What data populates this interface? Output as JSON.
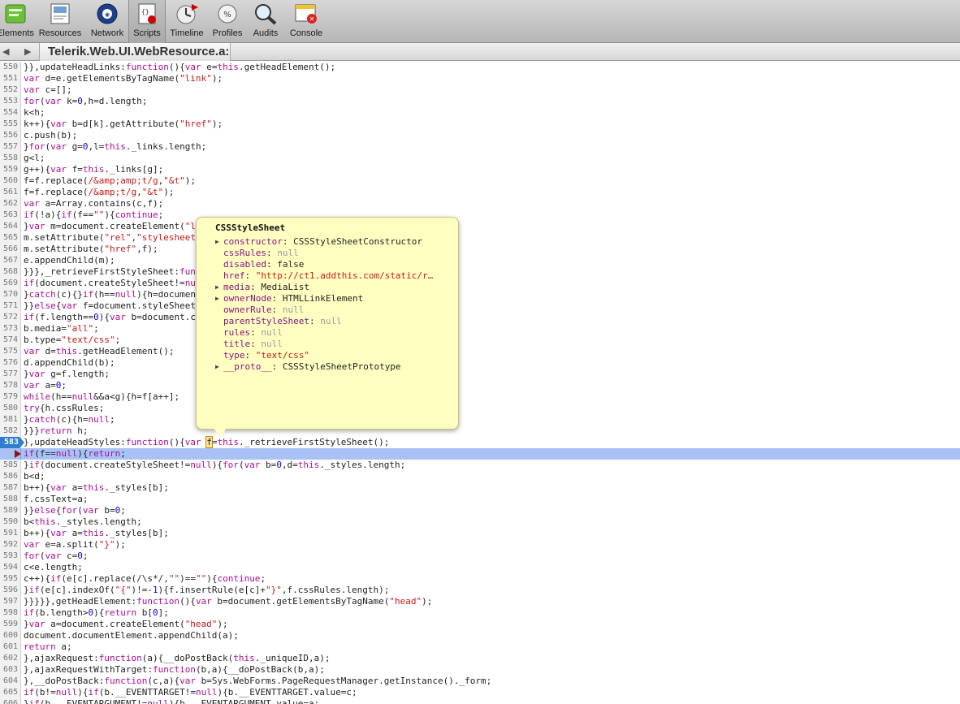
{
  "toolbar": {
    "items": [
      {
        "label": "Elements",
        "icon": "elements-icon",
        "active": false,
        "w": 46
      },
      {
        "label": "Resources",
        "icon": "resources-icon",
        "active": false,
        "w": 64
      },
      {
        "label": "Network",
        "icon": "network-icon",
        "active": false,
        "w": 52
      },
      {
        "label": "Scripts",
        "icon": "scripts-icon",
        "active": true,
        "w": 46
      },
      {
        "label": "Timeline",
        "icon": "timeline-icon",
        "active": false,
        "w": 52
      },
      {
        "label": "Profiles",
        "icon": "profiles-icon",
        "active": false,
        "w": 48
      },
      {
        "label": "Audits",
        "icon": "audits-icon",
        "active": false,
        "w": 46
      },
      {
        "label": "Console",
        "icon": "console-icon",
        "active": false,
        "w": 54
      }
    ]
  },
  "tabbar": {
    "back_icon": "back-arrow-icon",
    "forward_icon": "forward-arrow-icon",
    "file_tab": "Telerik.Web.UI.WebResource.a:"
  },
  "code": {
    "lines": [
      {
        "n": "550",
        "t": "}},updateHeadLinks:function(){var e=this.getHeadElement();"
      },
      {
        "n": "551",
        "t": "var d=e.getElementsByTagName(\"link\");"
      },
      {
        "n": "552",
        "t": "var c=[];"
      },
      {
        "n": "553",
        "t": "for(var k=0,h=d.length;"
      },
      {
        "n": "554",
        "t": "k<h;"
      },
      {
        "n": "555",
        "t": "k++){var b=d[k].getAttribute(\"href\");"
      },
      {
        "n": "556",
        "t": "c.push(b);"
      },
      {
        "n": "557",
        "t": "}for(var g=0,l=this._links.length;"
      },
      {
        "n": "558",
        "t": "g<l;"
      },
      {
        "n": "559",
        "t": "g++){var f=this._links[g];"
      },
      {
        "n": "560",
        "t": "f=f.replace(/&amp;amp;t/g,\"&t\");"
      },
      {
        "n": "561",
        "t": "f=f.replace(/&amp;t/g,\"&t\");"
      },
      {
        "n": "562",
        "t": "var a=Array.contains(c,f);"
      },
      {
        "n": "563",
        "t": "if(!a){if(f==\"\"){continue;"
      },
      {
        "n": "564",
        "t": "}var m=document.createElement(\"link\");"
      },
      {
        "n": "565",
        "t": "m.setAttribute(\"rel\",\"stylesheet\");"
      },
      {
        "n": "566",
        "t": "m.setAttribute(\"href\",f);"
      },
      {
        "n": "567",
        "t": "e.appendChild(m);"
      },
      {
        "n": "568",
        "t": "}}},_retrieveFirstStyleSheet:function(){"
      },
      {
        "n": "569",
        "t": "if(document.createStyleSheet!=null){"
      },
      {
        "n": "570",
        "t": "}catch(c){}if(h==null){h=document"
      },
      {
        "n": "571",
        "t": "}}else{var f=document.styleSheets;"
      },
      {
        "n": "572",
        "t": "if(f.length==0){var b=document.createElement(\"style\");"
      },
      {
        "n": "573",
        "t": "b.media=\"all\";"
      },
      {
        "n": "574",
        "t": "b.type=\"text/css\";"
      },
      {
        "n": "575",
        "t": "var d=this.getHeadElement();"
      },
      {
        "n": "576",
        "t": "d.appendChild(b);"
      },
      {
        "n": "577",
        "t": "}var g=f.length;"
      },
      {
        "n": "578",
        "t": "var a=0;"
      },
      {
        "n": "579",
        "t": "while(h==null&&a<g){h=f[a++];"
      },
      {
        "n": "580",
        "t": "try{h.cssRules;"
      },
      {
        "n": "581",
        "t": "}catch(c){h=null;"
      },
      {
        "n": "582",
        "t": "}}}return h;"
      },
      {
        "n": "583",
        "t": "},updateHeadStyles:function(){var f=this._retrieveFirstStyleSheet();",
        "breakpoint": true
      },
      {
        "n": "584",
        "t": "if(f==null){return;",
        "exec": true
      },
      {
        "n": "585",
        "t": "}if(document.createStyleSheet!=null){for(var b=0,d=this._styles.length;"
      },
      {
        "n": "586",
        "t": "b<d;"
      },
      {
        "n": "587",
        "t": "b++){var a=this._styles[b];"
      },
      {
        "n": "588",
        "t": "f.cssText=a;"
      },
      {
        "n": "589",
        "t": "}}else{for(var b=0;"
      },
      {
        "n": "590",
        "t": "b<this._styles.length;"
      },
      {
        "n": "591",
        "t": "b++){var a=this._styles[b];"
      },
      {
        "n": "592",
        "t": "var e=a.split(\"}\");"
      },
      {
        "n": "593",
        "t": "for(var c=0;"
      },
      {
        "n": "594",
        "t": "c<e.length;"
      },
      {
        "n": "595",
        "t": "c++){if(e[c].replace(/\\s*/,\"\")==\"\"){continue;"
      },
      {
        "n": "596",
        "t": "}if(e[c].indexOf(\"{\")!=-1){f.insertRule(e[c]+\"}\",f.cssRules.length);"
      },
      {
        "n": "597",
        "t": "}}}}},getHeadElement:function(){var b=document.getElementsByTagName(\"head\");"
      },
      {
        "n": "598",
        "t": "if(b.length>0){return b[0];"
      },
      {
        "n": "599",
        "t": "}var a=document.createElement(\"head\");"
      },
      {
        "n": "600",
        "t": "document.documentElement.appendChild(a);"
      },
      {
        "n": "601",
        "t": "return a;"
      },
      {
        "n": "602",
        "t": "},ajaxRequest:function(a){__doPostBack(this._uniqueID,a);"
      },
      {
        "n": "603",
        "t": "},ajaxRequestWithTarget:function(b,a){__doPostBack(b,a);"
      },
      {
        "n": "604",
        "t": "},__doPostBack:function(c,a){var b=Sys.WebForms.PageRequestManager.getInstance()._form;"
      },
      {
        "n": "605",
        "t": "if(b!=null){if(b.__EVENTTARGET!=null){b.__EVENTTARGET.value=c;"
      },
      {
        "n": "606",
        "t": "}if(b.__EVENTARGUMENT!=null){b.__EVENTARGUMENT.value=a;"
      }
    ]
  },
  "popover": {
    "title": "CSSStyleSheet",
    "rows": [
      {
        "key": "constructor",
        "value": "CSSStyleSheetConstructor",
        "kind": "obj",
        "expandable": true
      },
      {
        "key": "cssRules",
        "value": "null",
        "kind": "null",
        "expandable": false
      },
      {
        "key": "disabled",
        "value": "false",
        "kind": "obj",
        "expandable": false
      },
      {
        "key": "href",
        "value": "\"http://ct1.addthis.com/static/r…",
        "kind": "str",
        "expandable": false
      },
      {
        "key": "media",
        "value": "MediaList",
        "kind": "obj",
        "expandable": true
      },
      {
        "key": "ownerNode",
        "value": "HTMLLinkElement",
        "kind": "obj",
        "expandable": true
      },
      {
        "key": "ownerRule",
        "value": "null",
        "kind": "null",
        "expandable": false
      },
      {
        "key": "parentStyleSheet",
        "value": "null",
        "kind": "null",
        "expandable": false
      },
      {
        "key": "rules",
        "value": "null",
        "kind": "null",
        "expandable": false
      },
      {
        "key": "title",
        "value": "null",
        "kind": "null",
        "expandable": false
      },
      {
        "key": "type",
        "value": "\"text/css\"",
        "kind": "str",
        "expandable": false
      },
      {
        "key": "__proto__",
        "value": "CSSStyleSheetPrototype",
        "kind": "obj",
        "expandable": true
      }
    ]
  }
}
